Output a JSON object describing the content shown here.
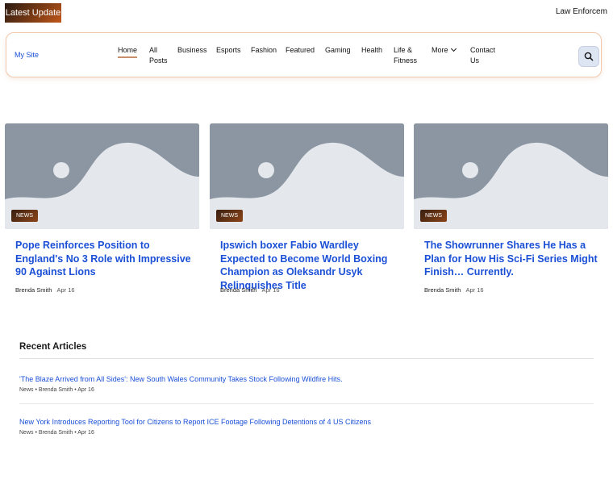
{
  "ticker": {
    "label": "Latest Update",
    "headline": "Law Enforcem"
  },
  "header": {
    "site_name": "My Site",
    "nav": [
      {
        "label": "Home"
      },
      {
        "label": "All Posts"
      },
      {
        "label": "Business"
      },
      {
        "label": "Esports"
      },
      {
        "label": "Fashion"
      },
      {
        "label": "Featured"
      },
      {
        "label": "Gaming"
      },
      {
        "label": "Health"
      },
      {
        "label": "Life & Fitness"
      },
      {
        "label": "More"
      },
      {
        "label": "Contact Us"
      }
    ],
    "search_icon": "search-icon"
  },
  "featured": [
    {
      "category": "NEWS",
      "title": "Pope Reinforces Position to England's No 3 Role with Impressive 90 Against Lions",
      "author": "Brenda Smith",
      "date": "Apr 16"
    },
    {
      "category": "NEWS",
      "title": "Ipswich boxer Fabio Wardley Expected to Become World Boxing Champion as Oleksandr Usyk Relinquishes Title",
      "author": "Brenda Smith",
      "date": "Apr 16"
    },
    {
      "category": "NEWS",
      "title": "The Showrunner Shares He Has a Plan for How His Sci-Fi Series Might Finish… Currently.",
      "author": "Brenda Smith",
      "date": "Apr 16"
    }
  ],
  "recent": {
    "heading": "Recent Articles",
    "items": [
      {
        "title": "'The Blaze Arrived from All Sides': New South Wales Community Takes Stock Following Wildfire Hits.",
        "meta": "News • Brenda Smith • Apr 16"
      },
      {
        "title": "New York Introduces Reporting Tool for Citizens to Report ICE Footage Following Detentions of 4 US Citizens",
        "meta": "News • Brenda Smith • Apr 16"
      }
    ]
  },
  "colors": {
    "accent_link": "#1a4fd6",
    "badge_dark": "#3a1f10",
    "badge_light": "#c0581a",
    "header_border": "#f0c9ad",
    "placeholder": "#8b96a2"
  }
}
